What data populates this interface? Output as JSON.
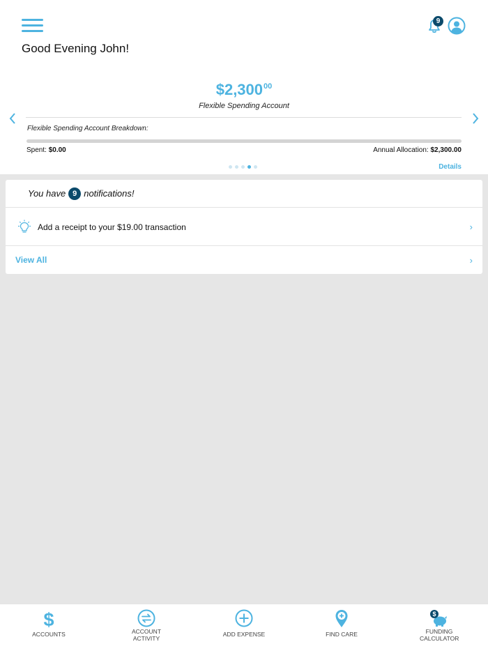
{
  "header": {
    "greeting": "Good Evening John!",
    "notification_badge": "9"
  },
  "account": {
    "amount_main": "$2,300",
    "amount_cents": "00",
    "name": "Flexible Spending Account",
    "breakdown_label": "Flexible Spending Account Breakdown:",
    "spent_label": "Spent:",
    "spent_value": "$0.00",
    "allocation_label": "Annual Allocation:",
    "allocation_value": "$2,300.00",
    "spent_fraction": 0,
    "details_label": "Details",
    "pages_total": 5,
    "page_active": 4
  },
  "notifications": {
    "prefix": "You have",
    "count": "9",
    "suffix": "notifications!",
    "items": [
      {
        "text": "Add a receipt to your $19.00 transaction",
        "icon": "lightbulb-icon"
      }
    ],
    "view_all_label": "View All"
  },
  "tabbar": {
    "items": [
      {
        "label": "ACCOUNTS",
        "icon": "dollar-icon"
      },
      {
        "label": "ACCOUNT ACTIVITY",
        "icon": "transfer-icon"
      },
      {
        "label": "ADD EXPENSE",
        "icon": "plus-circle-icon"
      },
      {
        "label": "FIND CARE",
        "icon": "map-pin-icon"
      },
      {
        "label": "FUNDING CALCULATOR",
        "icon": "piggy-bank-icon"
      }
    ]
  },
  "colors": {
    "accent": "#4db3e0",
    "badge": "#0b4a6b",
    "background": "#e6e6e6"
  }
}
